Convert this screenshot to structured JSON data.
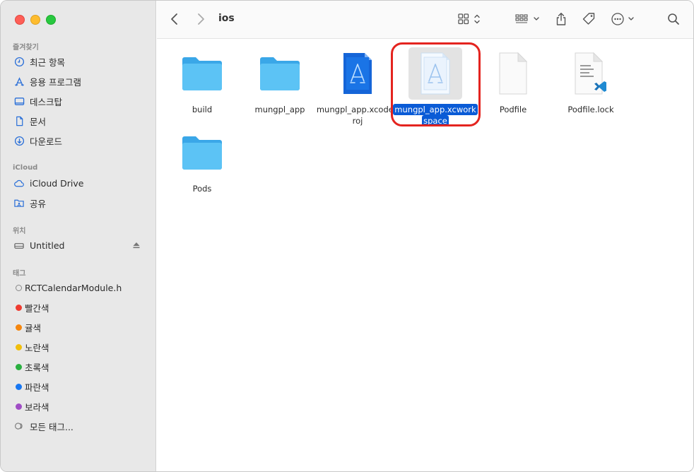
{
  "window": {
    "title": "ios"
  },
  "sidebar": {
    "favorites_title": "즐겨찾기",
    "favorites": [
      {
        "label": "최근 항목",
        "icon": "clock-icon"
      },
      {
        "label": "응용 프로그램",
        "icon": "applications-icon"
      },
      {
        "label": "데스크탑",
        "icon": "desktop-icon"
      },
      {
        "label": "문서",
        "icon": "document-icon"
      },
      {
        "label": "다운로드",
        "icon": "download-icon"
      }
    ],
    "icloud_title": "iCloud",
    "icloud": [
      {
        "label": "iCloud Drive",
        "icon": "cloud-icon"
      },
      {
        "label": "공유",
        "icon": "shared-folder-icon"
      }
    ],
    "locations_title": "위치",
    "locations": [
      {
        "label": "Untitled",
        "icon": "drive-icon"
      }
    ],
    "tags_title": "태그",
    "tags": [
      {
        "label": "RCTCalendarModule.h",
        "color": "#ffffff"
      },
      {
        "label": "빨간색",
        "color": "#ef3b30"
      },
      {
        "label": "귤색",
        "color": "#f5860e"
      },
      {
        "label": "노란색",
        "color": "#f1be0b"
      },
      {
        "label": "초록색",
        "color": "#2ab040"
      },
      {
        "label": "파란색",
        "color": "#1877f2"
      },
      {
        "label": "보라색",
        "color": "#a04dc5"
      },
      {
        "label": "모든 태그...",
        "color": null
      }
    ]
  },
  "toolbar": {
    "icons": [
      "back-chevron-icon",
      "forward-chevron-icon",
      "icon-view-icon",
      "group-icon",
      "share-icon",
      "tag-icon",
      "more-icon",
      "search-icon"
    ]
  },
  "files": [
    {
      "name": "build",
      "type": "folder"
    },
    {
      "name": "mungpl_app",
      "type": "folder"
    },
    {
      "name": "mungpl_app.xcodeproj",
      "type": "xcodeproj"
    },
    {
      "name": "mungpl_app.xcworkspace",
      "type": "xcworkspace",
      "selected": true
    },
    {
      "name": "Podfile",
      "type": "document"
    },
    {
      "name": "Podfile.lock",
      "type": "vscode-document"
    },
    {
      "name": "Pods",
      "type": "folder"
    }
  ],
  "colors": {
    "selection": "#0a5bd6",
    "annotation": "#e4241f",
    "folder": "#56b9f0"
  }
}
